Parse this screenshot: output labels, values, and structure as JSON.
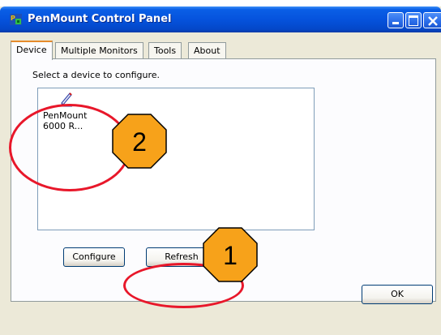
{
  "window": {
    "title": "PenMount Control Panel"
  },
  "tabs": [
    {
      "label": "Device",
      "active": true
    },
    {
      "label": "Multiple Monitors",
      "active": false
    },
    {
      "label": "Tools",
      "active": false
    },
    {
      "label": "About",
      "active": false
    }
  ],
  "device_panel": {
    "prompt": "Select a device to configure.",
    "devices": [
      {
        "label_line1": "PenMount",
        "label_line2": "6000 R...",
        "icon": "pen-icon"
      }
    ]
  },
  "buttons": {
    "configure": "Configure",
    "refresh": "Refresh",
    "ok": "OK"
  },
  "callouts": [
    {
      "number": "1",
      "color": "#f7a21a"
    },
    {
      "number": "2",
      "color": "#f7a21a"
    }
  ],
  "colors": {
    "titlebar": "#0553dd",
    "callout_ring": "#e8172a",
    "callout_fill": "#f7a21a"
  }
}
